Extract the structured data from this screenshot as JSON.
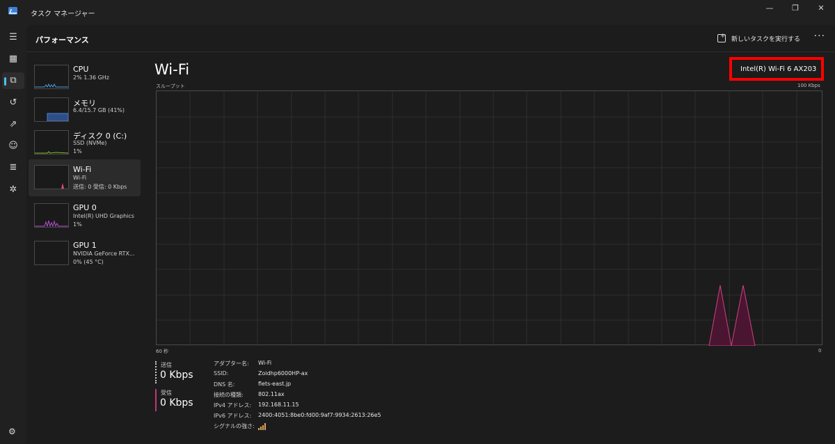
{
  "window": {
    "title": "タスク マネージャー",
    "controls": {
      "minimize": "—",
      "maximize": "❐",
      "close": "✕"
    }
  },
  "rail": {
    "items": [
      {
        "icon": "hamburger-icon",
        "glyph": "☰"
      },
      {
        "icon": "processes-icon",
        "glyph": "▦"
      },
      {
        "icon": "performance-icon",
        "glyph": "⧉",
        "active": true
      },
      {
        "icon": "app-history-icon",
        "glyph": "↺"
      },
      {
        "icon": "startup-apps-icon",
        "glyph": "⇗"
      },
      {
        "icon": "users-icon",
        "glyph": "☺"
      },
      {
        "icon": "details-icon",
        "glyph": "≣"
      },
      {
        "icon": "services-icon",
        "glyph": "✲"
      }
    ],
    "settings_glyph": "⚙"
  },
  "header": {
    "page_title": "パフォーマンス",
    "run_task": "新しいタスクを実行する",
    "more": "···"
  },
  "devices": [
    {
      "name": "CPU",
      "sub1": "2%  1.36 GHz",
      "sub2": "",
      "color": "#4a9eda"
    },
    {
      "name": "メモリ",
      "sub1": "6.4/15.7 GB (41%)",
      "sub2": "",
      "color": "#4a7fd8"
    },
    {
      "name": "ディスク 0 (C:)",
      "sub1": "SSD (NVMe)",
      "sub2": "1%",
      "color": "#7fbf2e"
    },
    {
      "name": "Wi-Fi",
      "sub1": "Wi-Fi",
      "sub2": "送信: 0  受信: 0 Kbps",
      "color": "#e0488a",
      "selected": true
    },
    {
      "name": "GPU 0",
      "sub1": "Intel(R) UHD Graphics",
      "sub2": "1%",
      "color": "#b44fd0"
    },
    {
      "name": "GPU 1",
      "sub1": "NVIDIA GeForce RTX...",
      "sub2": "0%  (45 °C)",
      "color": "#b44fd0"
    }
  ],
  "detail": {
    "title": "Wi-Fi",
    "adapter": "Intel(R) Wi-Fi 6 AX203",
    "graph_label": "スループット",
    "max_label": "100 Kbps",
    "time_left": "60 秒",
    "time_right": "0",
    "send_label": "送信",
    "send_value": "0 Kbps",
    "recv_label": "受信",
    "recv_value": "0 Kbps",
    "info": [
      {
        "key": "アダプター名:",
        "value": "Wi-Fi"
      },
      {
        "key": "SSID:",
        "value": "Zoidhp6000HP-ax"
      },
      {
        "key": "DNS 名:",
        "value": "flets-east.jp"
      },
      {
        "key": "接続の種類:",
        "value": "802.11ax"
      },
      {
        "key": "IPv4 アドレス:",
        "value": "192.168.11.15"
      },
      {
        "key": "IPv6 アドレス:",
        "value": "2400:4051:8be0:fd00:9af7:9934:2613:26e5"
      },
      {
        "key": "シグナルの強さ:",
        "value": "",
        "icon": "signal-strength-icon",
        "bars": 4
      }
    ]
  },
  "colors": {
    "accent": "#4cc2ff",
    "wifi": "#c2367a",
    "highlight": "#ff0000"
  }
}
